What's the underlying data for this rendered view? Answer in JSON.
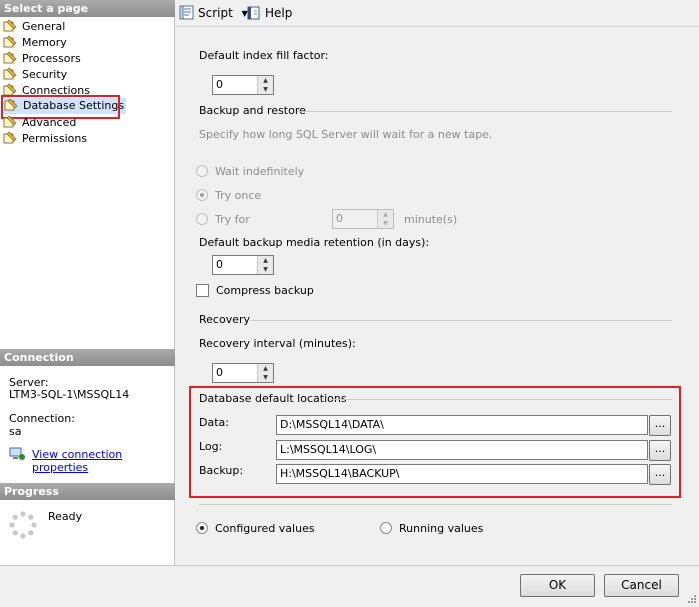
{
  "left_pane": {
    "select_page_header": "Select a page",
    "pages": [
      {
        "label": "General"
      },
      {
        "label": "Memory"
      },
      {
        "label": "Processors"
      },
      {
        "label": "Security"
      },
      {
        "label": "Connections"
      },
      {
        "label": "Database Settings",
        "selected": true
      },
      {
        "label": "Advanced"
      },
      {
        "label": "Permissions"
      }
    ],
    "connection_header": "Connection",
    "server_label": "Server:",
    "server_value": "LTM3-SQL-1\\MSSQL14",
    "connection_label": "Connection:",
    "connection_value": "sa",
    "view_props_link": "View connection properties",
    "progress_header": "Progress",
    "progress_status": "Ready"
  },
  "toolbar": {
    "script_label": "Script",
    "help_label": "Help"
  },
  "settings": {
    "fill_factor_label": "Default index fill factor:",
    "fill_factor_value": "0",
    "backup_group": "Backup and restore",
    "backup_desc": "Specify how long SQL Server will wait for a new tape.",
    "wait_indef_label": "Wait indefinitely",
    "try_once_label": "Try once",
    "try_for_label": "Try for",
    "try_for_value": "0",
    "minutes_label": "minute(s)",
    "retention_label": "Default backup media retention (in days):",
    "retention_value": "0",
    "compress_label": "Compress backup",
    "recovery_group": "Recovery",
    "recovery_interval_label": "Recovery interval (minutes):",
    "recovery_interval_value": "0",
    "locations_group": "Database default locations",
    "data_label": "Data:",
    "data_value": "D:\\MSSQL14\\DATA\\",
    "log_label": "Log:",
    "log_value": "L:\\MSSQL14\\LOG\\",
    "backup_label": "Backup:",
    "backup_value": "H:\\MSSQL14\\BACKUP\\",
    "browse_label": "...",
    "configured_label": "Configured values",
    "running_label": "Running values"
  },
  "footer": {
    "ok_label": "OK",
    "cancel_label": "Cancel"
  },
  "colors": {
    "highlight_red": "#e51d2a",
    "section_header": "#9a9a9a",
    "link_blue": "#0000ee"
  }
}
